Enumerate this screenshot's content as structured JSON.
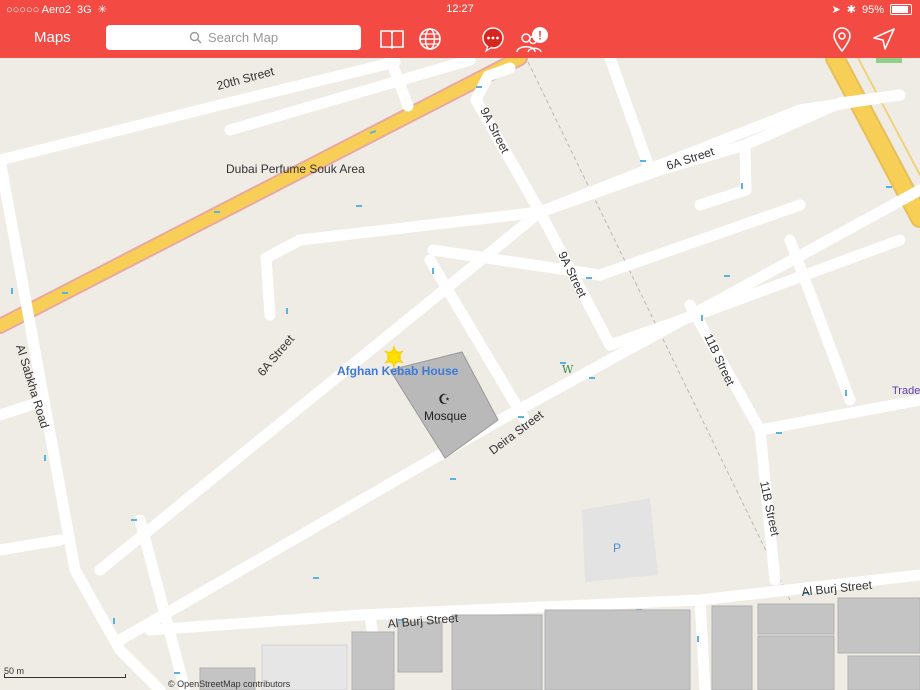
{
  "statusbar": {
    "carrier": "○○○○○ Aero2",
    "network": "3G",
    "time": "12:27",
    "battery": "95%"
  },
  "navbar": {
    "title": "Maps",
    "search_placeholder": "Search Map"
  },
  "map": {
    "streets": [
      "20th Street",
      "9A Street",
      "6A Street",
      "9A Street",
      "6A Street",
      "11B Street",
      "Deira Street",
      "11B Street",
      "Al Sabkha Road",
      "Al Burj Street",
      "Al Burj Street"
    ],
    "area_label": "Dubai Perfume Souk Area",
    "poi": {
      "name": "Afghan Kebab House",
      "mosque": "Mosque",
      "parking": "P",
      "w_marker": "W",
      "trade": "Trade"
    },
    "scale": "50 m",
    "attribution": "© OpenStreetMap contributors"
  },
  "colors": {
    "accent": "#f34a43",
    "map_bg": "#efece6",
    "road": "#ffffff",
    "highway": "#f7cf56",
    "building": "#c9c9c9"
  }
}
